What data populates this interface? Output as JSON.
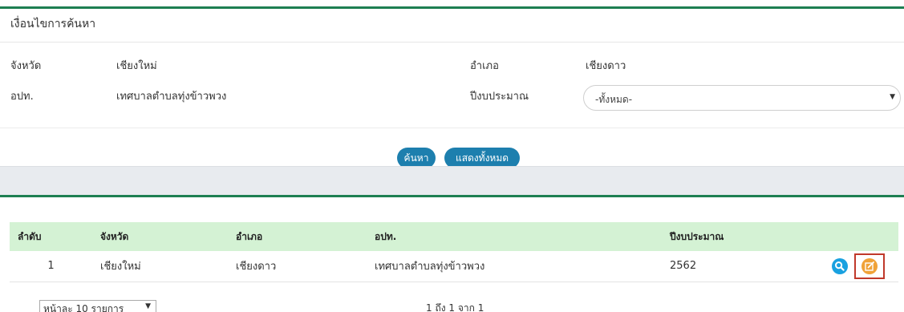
{
  "search": {
    "title": "เงื่อนไขการค้นหา",
    "province_label": "จังหวัด",
    "province_value": "เชียงใหม่",
    "district_label": "อำเภอ",
    "district_value": "เชียงดาว",
    "org_label": "อปท.",
    "org_value": "เทศบาลตำบลทุ่งข้าวพวง",
    "year_label": "ปีงบประมาณ",
    "year_selected": "-ทั้งหมด-",
    "search_button": "ค้นหา",
    "show_all_button": "แสดงทั้งหมด"
  },
  "table": {
    "headers": [
      "ลำดับ",
      "จังหวัด",
      "อำเภอ",
      "อปท.",
      "ปีงบประมาณ",
      ""
    ],
    "rows": [
      [
        "1",
        "เชียงใหม่",
        "เชียงดาว",
        "เทศบาลตำบลทุ่งข้าวพวง",
        "2562"
      ]
    ]
  },
  "footer": {
    "page_size": "หน้าละ 10 รายการ",
    "page_info": "1 ถึง 1 จาก 1"
  },
  "icons": {
    "view": "search-icon",
    "edit": "edit-icon",
    "dropdown": "chevron-down-icon"
  },
  "colors": {
    "brand_green": "#1e7f52",
    "button_blue": "#1d7fae",
    "header_green": "#d4f2d4",
    "view_icon": "#19a1e0",
    "edit_icon": "#f0a238",
    "highlight_red": "#c0392b"
  }
}
